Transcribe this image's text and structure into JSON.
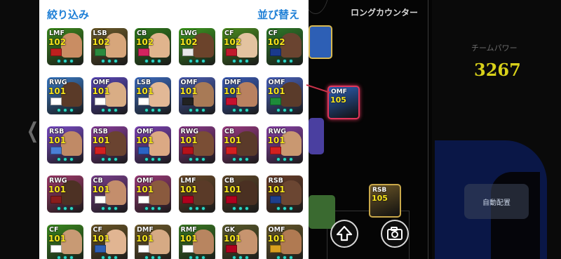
{
  "panel": {
    "filter_label": "絞り込み",
    "sort_label": "並び替え"
  },
  "players": [
    {
      "pos": "LMF",
      "rating": "102",
      "bg": "#3c8a1e",
      "face": "#c98d63",
      "emblem": "#c0201e"
    },
    {
      "pos": "LSB",
      "rating": "102",
      "bg": "#6b5a2a",
      "face": "#d7a67b",
      "emblem": "#2b8a3e"
    },
    {
      "pos": "CB",
      "rating": "102",
      "bg": "#2f7a1c",
      "face": "#e0b48d",
      "emblem": "#d2235f"
    },
    {
      "pos": "LWG",
      "rating": "102",
      "bg": "#3e9a21",
      "face": "#6b432b",
      "emblem": "#e8e8e8"
    },
    {
      "pos": "CF",
      "rating": "102",
      "bg": "#4a8b1f",
      "face": "#e3c3a0",
      "emblem": "#c01a2c"
    },
    {
      "pos": "CF",
      "rating": "102",
      "bg": "#2e7a28",
      "face": "#6a4430",
      "emblem": "#1a3a8c"
    },
    {
      "pos": "RWG",
      "rating": "101",
      "bg": "#3a7ac4",
      "face": "#5a3a28",
      "emblem": "#ffffff"
    },
    {
      "pos": "OMF",
      "rating": "101",
      "bg": "#5a48b8",
      "face": "#d9ad85",
      "emblem": "#ffffff"
    },
    {
      "pos": "LSB",
      "rating": "101",
      "bg": "#3d6cc0",
      "face": "#e2b896",
      "emblem": "#ffffff"
    },
    {
      "pos": "OMF",
      "rating": "101",
      "bg": "#4b5fb3",
      "face": "#a87a56",
      "emblem": "#222222"
    },
    {
      "pos": "DMF",
      "rating": "101",
      "bg": "#3c5db8",
      "face": "#b98160",
      "emblem": "#c8102e"
    },
    {
      "pos": "OMF",
      "rating": "101",
      "bg": "#4a63bd",
      "face": "#5a3b2a",
      "emblem": "#1d8c3a"
    },
    {
      "pos": "RSB",
      "rating": "101",
      "bg": "#7a4cc6",
      "face": "#c08a66",
      "emblem": "#4a7fd6"
    },
    {
      "pos": "RSB",
      "rating": "101",
      "bg": "#8a3e9c",
      "face": "#6a4330",
      "emblem": "#d32020"
    },
    {
      "pos": "OMF",
      "rating": "101",
      "bg": "#7e43b6",
      "face": "#dba984",
      "emblem": "#2a63c4"
    },
    {
      "pos": "RWG",
      "rating": "101",
      "bg": "#8c3a8a",
      "face": "#7a4e35",
      "emblem": "#b5121b"
    },
    {
      "pos": "CB",
      "rating": "101",
      "bg": "#9a3a82",
      "face": "#5a3a2a",
      "emblem": "#d32020"
    },
    {
      "pos": "RWG",
      "rating": "101",
      "bg": "#8a42a8",
      "face": "#c99871",
      "emblem": "#d32020"
    },
    {
      "pos": "RWG",
      "rating": "101",
      "bg": "#a03a6a",
      "face": "#4d3124",
      "emblem": "#8a1c1c"
    },
    {
      "pos": "CB",
      "rating": "101",
      "bg": "#7a3f8c",
      "face": "#c48e6c",
      "emblem": "#ffffff"
    },
    {
      "pos": "OMF",
      "rating": "101",
      "bg": "#9c3a78",
      "face": "#8a5a3e",
      "emblem": "#ffffff"
    },
    {
      "pos": "LMF",
      "rating": "101",
      "bg": "#6a4a2a",
      "face": "#5a3a28",
      "emblem": "#b0001e"
    },
    {
      "pos": "CB",
      "rating": "101",
      "bg": "#5e4628",
      "face": "#4a3022",
      "emblem": "#b0001e"
    },
    {
      "pos": "RSB",
      "rating": "101",
      "bg": "#6a3e2a",
      "face": "#6b4632",
      "emblem": "#1e3f8c"
    },
    {
      "pos": "CF",
      "rating": "101",
      "bg": "#3a8a1e",
      "face": "#c89a74",
      "emblem": "#ffffff"
    },
    {
      "pos": "CF",
      "rating": "101",
      "bg": "#6a5526",
      "face": "#e1b592",
      "emblem": "#2d5fb5"
    },
    {
      "pos": "DMF",
      "rating": "101",
      "bg": "#6e5a2a",
      "face": "#d6aa84",
      "emblem": "#ffffff"
    },
    {
      "pos": "RMF",
      "rating": "101",
      "bg": "#3a7a22",
      "face": "#b88560",
      "emblem": "#ffffff"
    },
    {
      "pos": "GK",
      "rating": "101",
      "bg": "#5a5a2a",
      "face": "#c7946f",
      "emblem": "#b0001e"
    },
    {
      "pos": "OMF",
      "rating": "101",
      "bg": "#66582a",
      "face": "#b07a52",
      "emblem": "#d9a01e"
    }
  ],
  "pitch": {
    "long_counter_label": "ロングカウンター",
    "cards": [
      {
        "pos": "OMF",
        "rating": "105",
        "bg": "#2d5fb5"
      },
      {
        "pos": "RSB",
        "rating": "105",
        "bg": "#6a5526"
      }
    ]
  },
  "team_power": {
    "label": "チームパワー",
    "value": "3267"
  },
  "auto_button_label": "自動配置",
  "icons": {
    "back": "chevron-left-icon",
    "up": "arrow-up-icon",
    "camera": "camera-icon"
  }
}
